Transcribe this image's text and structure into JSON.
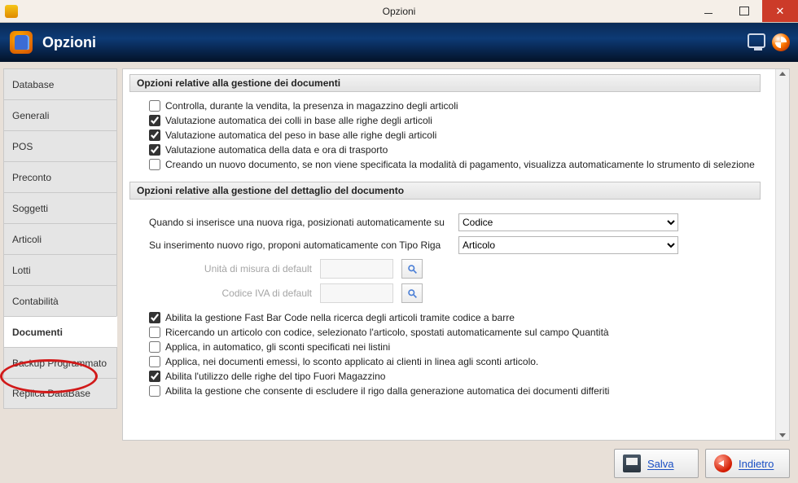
{
  "window": {
    "title": "Opzioni"
  },
  "header": {
    "title": "Opzioni"
  },
  "sidebar": {
    "items": [
      {
        "label": "Database"
      },
      {
        "label": "Generali"
      },
      {
        "label": "POS"
      },
      {
        "label": "Preconto"
      },
      {
        "label": "Soggetti"
      },
      {
        "label": "Articoli"
      },
      {
        "label": "Lotti"
      },
      {
        "label": "Contabilità"
      },
      {
        "label": "Documenti",
        "active": true
      },
      {
        "label": "Backup Programmato"
      },
      {
        "label": "Replica DataBase"
      }
    ]
  },
  "group1": {
    "title": "Opzioni relative alla gestione dei documenti",
    "items": [
      {
        "checked": false,
        "label": "Controlla, durante la vendita, la presenza in magazzino degli articoli"
      },
      {
        "checked": true,
        "label": "Valutazione automatica dei colli in base alle righe degli articoli"
      },
      {
        "checked": true,
        "label": "Valutazione automatica del peso in base alle righe degli articoli"
      },
      {
        "checked": true,
        "label": "Valutazione automatica della data e ora di trasporto"
      },
      {
        "checked": false,
        "label": "Creando un nuovo documento, se non viene specificata la modalità di pagamento, visualizza automaticamente lo strumento di selezione"
      }
    ]
  },
  "group2": {
    "title": "Opzioni relative alla gestione del dettaglio del documento",
    "row1": {
      "label": "Quando si inserisce una nuova riga, posizionati automaticamente su",
      "value": "Codice"
    },
    "row2": {
      "label": "Su inserimento nuovo rigo, proponi automaticamente con Tipo Riga",
      "value": "Articolo"
    },
    "row3": {
      "label": "Unità di misura di default"
    },
    "row4": {
      "label": "Codice IVA di default"
    },
    "items": [
      {
        "checked": true,
        "label": "Abilita la gestione Fast Bar Code nella ricerca degli articoli tramite codice a barre"
      },
      {
        "checked": false,
        "label": "Ricercando un articolo con codice, selezionato l'articolo, spostati automaticamente sul campo Quantità"
      },
      {
        "checked": false,
        "label": "Applica, in automatico, gli sconti specificati nei listini"
      },
      {
        "checked": false,
        "label": "Applica, nei documenti emessi, lo sconto applicato ai clienti in linea agli sconti articolo."
      },
      {
        "checked": true,
        "label": "Abilita l'utilizzo delle righe del tipo Fuori Magazzino"
      },
      {
        "checked": false,
        "label": "Abilita la gestione che consente di escludere il rigo dalla generazione automatica dei documenti differiti"
      }
    ]
  },
  "footer": {
    "save": "Salva",
    "back": "Indietro"
  }
}
